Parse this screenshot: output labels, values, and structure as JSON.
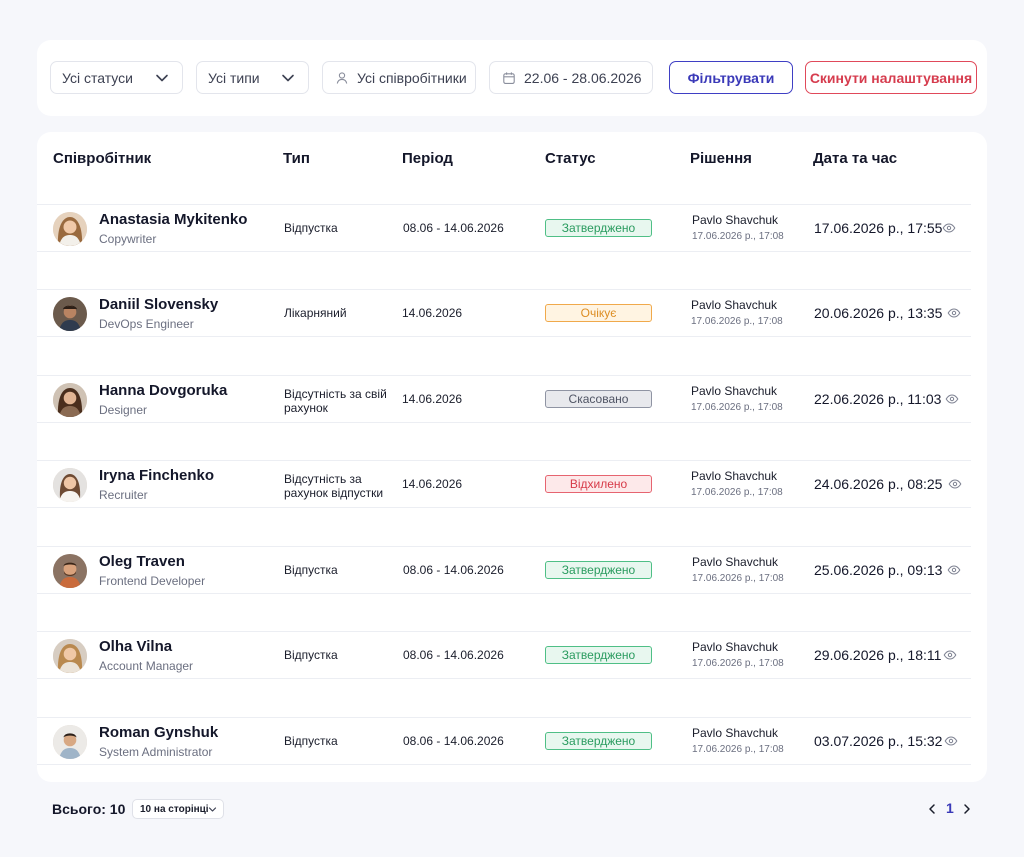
{
  "filters": {
    "status_label": "Усі статуси",
    "type_label": "Усі типи",
    "employees_label": "Усі співробітники",
    "date_range": "22.06 - 28.06.2026",
    "filter_button": "Фільтрувати",
    "reset_button": "Скинути налаштування",
    "filter_color": "#3a39b8",
    "reset_color": "#d63c4e"
  },
  "table": {
    "headers": {
      "employee": "Співробітник",
      "type": "Тип",
      "period": "Період",
      "status": "Статус",
      "decision": "Рішення",
      "datetime": "Дата та час"
    },
    "rows": [
      {
        "name": "Anastasia Mykitenko",
        "role": "Copywriter",
        "type": "Відпустка",
        "period": "08.06 - 14.06.2026",
        "status": "Затверджено",
        "decision_by": "Pavlo Shavchuk",
        "decision_date": "17.06.2026 р., 17:08",
        "datetime": "17.06.2026 р., 17:55"
      },
      {
        "name": "Daniil Slovensky",
        "role": "DevOps Engineer",
        "type": "Лікарняний",
        "period": "14.06.2026",
        "status": "Очікує",
        "decision_by": "Pavlo Shavchuk",
        "decision_date": "17.06.2026 р., 17:08",
        "datetime": "20.06.2026 р., 13:35"
      },
      {
        "name": "Hanna Dovgoruka",
        "role": "Designer",
        "type": "Відсутність за свій рахунок",
        "period": "14.06.2026",
        "status": "Скасовано",
        "decision_by": "Pavlo Shavchuk",
        "decision_date": "17.06.2026 р., 17:08",
        "datetime": "22.06.2026 р., 11:03"
      },
      {
        "name": "Iryna Finchenko",
        "role": "Recruiter",
        "type": "Відсутність за рахунок відпустки",
        "period": "14.06.2026",
        "status": "Відхилено",
        "decision_by": "Pavlo Shavchuk",
        "decision_date": "17.06.2026 р., 17:08",
        "datetime": "24.06.2026 р., 08:25"
      },
      {
        "name": "Oleg Traven",
        "role": "Frontend Developer",
        "type": "Відпустка",
        "period": "08.06 - 14.06.2026",
        "status": "Затверджено",
        "decision_by": "Pavlo Shavchuk",
        "decision_date": "17.06.2026 р., 17:08",
        "datetime": "25.06.2026 р., 09:13"
      },
      {
        "name": "Olha Vilna",
        "role": "Account Manager",
        "type": "Відпустка",
        "period": "08.06 - 14.06.2026",
        "status": "Затверджено",
        "decision_by": "Pavlo Shavchuk",
        "decision_date": "17.06.2026 р., 17:08",
        "datetime": "29.06.2026 р., 18:11"
      },
      {
        "name": "Roman Gynshuk",
        "role": "System Administrator",
        "type": "Відпустка",
        "period": "08.06 - 14.06.2026",
        "status": "Затверджено",
        "decision_by": "Pavlo Shavchuk",
        "decision_date": "17.06.2026 р., 17:08",
        "datetime": "03.07.2026 р., 15:32"
      }
    ]
  },
  "footer": {
    "total": "Всього: 10",
    "per_page": "10 на сторінці",
    "current_page": "1"
  }
}
